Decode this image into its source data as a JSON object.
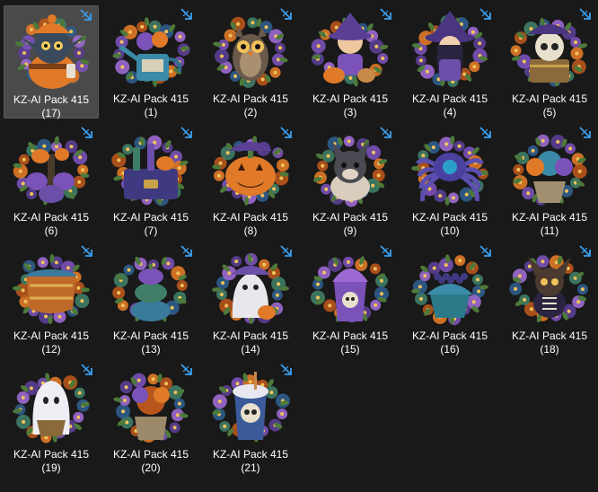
{
  "explorer": {
    "view": "large icons",
    "files": [
      {
        "name": "KZ-AI Pack 415",
        "number": "(17)",
        "subject": "gremlin-icon",
        "selected": true
      },
      {
        "name": "KZ-AI Pack 415",
        "number": "(1)",
        "subject": "watering-can-icon",
        "selected": false
      },
      {
        "name": "KZ-AI Pack 415",
        "number": "(2)",
        "subject": "owl-icon",
        "selected": false
      },
      {
        "name": "KZ-AI Pack 415",
        "number": "(3)",
        "subject": "girl-with-pumpkin-icon",
        "selected": false
      },
      {
        "name": "KZ-AI Pack 415",
        "number": "(4)",
        "subject": "witch-girl-icon",
        "selected": false
      },
      {
        "name": "KZ-AI Pack 415",
        "number": "(5)",
        "subject": "pirate-skull-chest-icon",
        "selected": false
      },
      {
        "name": "KZ-AI Pack 415",
        "number": "(6)",
        "subject": "pumpkin-tree-icon",
        "selected": false
      },
      {
        "name": "KZ-AI Pack 415",
        "number": "(7)",
        "subject": "potion-chest-icon",
        "selected": false
      },
      {
        "name": "KZ-AI Pack 415",
        "number": "(8)",
        "subject": "jack-o-lantern-icon",
        "selected": false
      },
      {
        "name": "KZ-AI Pack 415",
        "number": "(9)",
        "subject": "bulldog-icon",
        "selected": false
      },
      {
        "name": "KZ-AI Pack 415",
        "number": "(10)",
        "subject": "spider-icon",
        "selected": false
      },
      {
        "name": "KZ-AI Pack 415",
        "number": "(11)",
        "subject": "flower-pot-icon",
        "selected": false
      },
      {
        "name": "KZ-AI Pack 415",
        "number": "(12)",
        "subject": "cauldron-drum-icon",
        "selected": false
      },
      {
        "name": "KZ-AI Pack 415",
        "number": "(13)",
        "subject": "pumpkin-stack-icon",
        "selected": false
      },
      {
        "name": "KZ-AI Pack 415",
        "number": "(14)",
        "subject": "ghost-girl-icon",
        "selected": false
      },
      {
        "name": "KZ-AI Pack 415",
        "number": "(15)",
        "subject": "skull-cup-icon",
        "selected": false
      },
      {
        "name": "KZ-AI Pack 415",
        "number": "(16)",
        "subject": "berry-cupcake-icon",
        "selected": false
      },
      {
        "name": "KZ-AI Pack 415",
        "number": "(18)",
        "subject": "skeleton-cat-icon",
        "selected": false
      },
      {
        "name": "KZ-AI Pack 415",
        "number": "(19)",
        "subject": "ghost-with-basket-icon",
        "selected": false
      },
      {
        "name": "KZ-AI Pack 415",
        "number": "(20)",
        "subject": "autumn-pot-icon",
        "selected": false
      },
      {
        "name": "KZ-AI Pack 415",
        "number": "(21)",
        "subject": "skull-drink-cup-icon",
        "selected": false
      }
    ],
    "shortcut_icon": "shortcut-arrow-icon",
    "colors": {
      "background": "#191919",
      "selected_tile": "#4a4a4a",
      "label_text": "#ffffff",
      "shortcut_arrow": "#3a9ff0",
      "accent_purple": "#6b4fa8",
      "accent_orange": "#e07a28"
    }
  }
}
